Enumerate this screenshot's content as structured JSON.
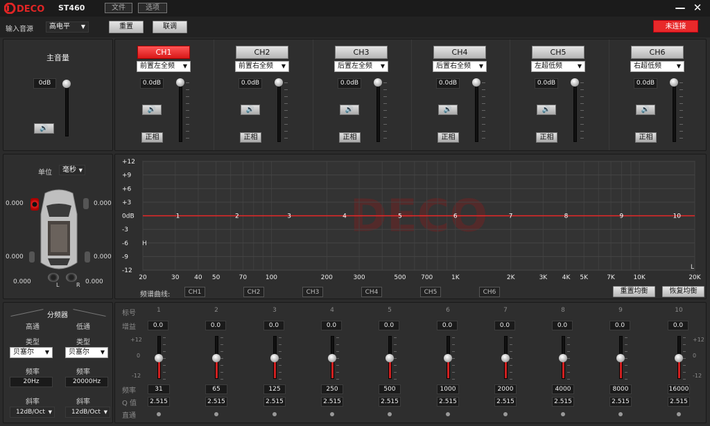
{
  "app": {
    "name": "ST460",
    "logo_text": "DECO"
  },
  "menu": {
    "file": "文件",
    "options": "选项"
  },
  "toolbar": {
    "input_label": "输入音源",
    "input_value": "高电平",
    "reset": "重置",
    "link": "联调",
    "status": "未连接",
    "status_color": "#e8292a"
  },
  "master": {
    "title": "主音量",
    "value": "0dB",
    "mute_icon": "speaker-icon"
  },
  "channels": [
    {
      "name": "CH1",
      "type": "前置左全频",
      "db": "0.0dB",
      "phase": "正相",
      "active": true
    },
    {
      "name": "CH2",
      "type": "前置右全频",
      "db": "0.0dB",
      "phase": "正相",
      "active": false
    },
    {
      "name": "CH3",
      "type": "后置左全频",
      "db": "0.0dB",
      "phase": "正相",
      "active": false
    },
    {
      "name": "CH4",
      "type": "后置右全频",
      "db": "0.0dB",
      "phase": "正相",
      "active": false
    },
    {
      "name": "CH5",
      "type": "左超低频",
      "db": "0.0dB",
      "phase": "正相",
      "active": false
    },
    {
      "name": "CH6",
      "type": "右超低频",
      "db": "0.0dB",
      "phase": "正相",
      "active": false
    }
  ],
  "delay": {
    "unit_label": "单位",
    "unit_value": "毫秒",
    "fl": "0.000",
    "fr": "0.000",
    "rl": "0.000",
    "rr": "0.000",
    "sub_l_value": "0.000",
    "sub_r_value": "0.000",
    "sub_l": "L",
    "sub_r": "R"
  },
  "chart_data": {
    "type": "line",
    "y_ticks": [
      "+12",
      "+9",
      "+6",
      "+3",
      "0dB",
      "-3",
      "-6",
      "-9",
      "-12"
    ],
    "ylim": [
      -12,
      12
    ],
    "x_ticks": [
      "20",
      "30",
      "40",
      "50",
      "70",
      "100",
      "200",
      "300",
      "500",
      "700",
      "1K",
      "2K",
      "3K",
      "4K",
      "5K",
      "7K",
      "10K",
      "20K"
    ],
    "x_tick_values": [
      20,
      30,
      40,
      50,
      70,
      100,
      200,
      300,
      500,
      700,
      1000,
      2000,
      3000,
      4000,
      5000,
      7000,
      10000,
      20000
    ],
    "xlim": [
      20,
      20000
    ],
    "x_scale": "log",
    "points": [
      {
        "label": "1",
        "x": 31,
        "y": 0
      },
      {
        "label": "2",
        "x": 65,
        "y": 0
      },
      {
        "label": "3",
        "x": 125,
        "y": 0
      },
      {
        "label": "4",
        "x": 250,
        "y": 0
      },
      {
        "label": "5",
        "x": 500,
        "y": 0
      },
      {
        "label": "6",
        "x": 1000,
        "y": 0
      },
      {
        "label": "7",
        "x": 2000,
        "y": 0
      },
      {
        "label": "8",
        "x": 4000,
        "y": 0
      },
      {
        "label": "9",
        "x": 8000,
        "y": 0
      },
      {
        "label": "10",
        "x": 16000,
        "y": 0
      }
    ],
    "corner_h": "H",
    "corner_l": "L",
    "curve_color": "#e82828",
    "grid": true
  },
  "curves": {
    "label": "频谱曲线:",
    "items": [
      "CH1",
      "CH2",
      "CH3",
      "CH4",
      "CH5",
      "CH6"
    ]
  },
  "eq_actions": {
    "reset_eq": "重置均衡",
    "restore_eq": "恢复均衡"
  },
  "crossover": {
    "title": "分频器",
    "hp": {
      "label": "高通",
      "type_label": "类型",
      "type": "贝塞尔",
      "freq_label": "频率",
      "freq": "20Hz",
      "slope_label": "斜率",
      "slope": "12dB/Oct"
    },
    "lp": {
      "label": "低通",
      "type_label": "类型",
      "type": "贝塞尔",
      "freq_label": "频率",
      "freq": "20000Hz",
      "slope_label": "斜率",
      "slope": "12dB/Oct"
    }
  },
  "eq": {
    "row_labels": {
      "band": "标号",
      "gain": "增益",
      "freq": "频率",
      "q": "Q 值",
      "bypass": "直通"
    },
    "scale": {
      "top": "+12",
      "mid": "0",
      "bot": "-12"
    },
    "bands": [
      {
        "num": "1",
        "gain": "0.0",
        "freq": "31",
        "q": "2.515"
      },
      {
        "num": "2",
        "gain": "0.0",
        "freq": "65",
        "q": "2.515"
      },
      {
        "num": "3",
        "gain": "0.0",
        "freq": "125",
        "q": "2.515"
      },
      {
        "num": "4",
        "gain": "0.0",
        "freq": "250",
        "q": "2.515"
      },
      {
        "num": "5",
        "gain": "0.0",
        "freq": "500",
        "q": "2.515"
      },
      {
        "num": "6",
        "gain": "0.0",
        "freq": "1000",
        "q": "2.515"
      },
      {
        "num": "7",
        "gain": "0.0",
        "freq": "2000",
        "q": "2.515"
      },
      {
        "num": "8",
        "gain": "0.0",
        "freq": "4000",
        "q": "2.515"
      },
      {
        "num": "9",
        "gain": "0.0",
        "freq": "8000",
        "q": "2.515"
      },
      {
        "num": "10",
        "gain": "0.0",
        "freq": "16000",
        "q": "2.515"
      }
    ]
  }
}
